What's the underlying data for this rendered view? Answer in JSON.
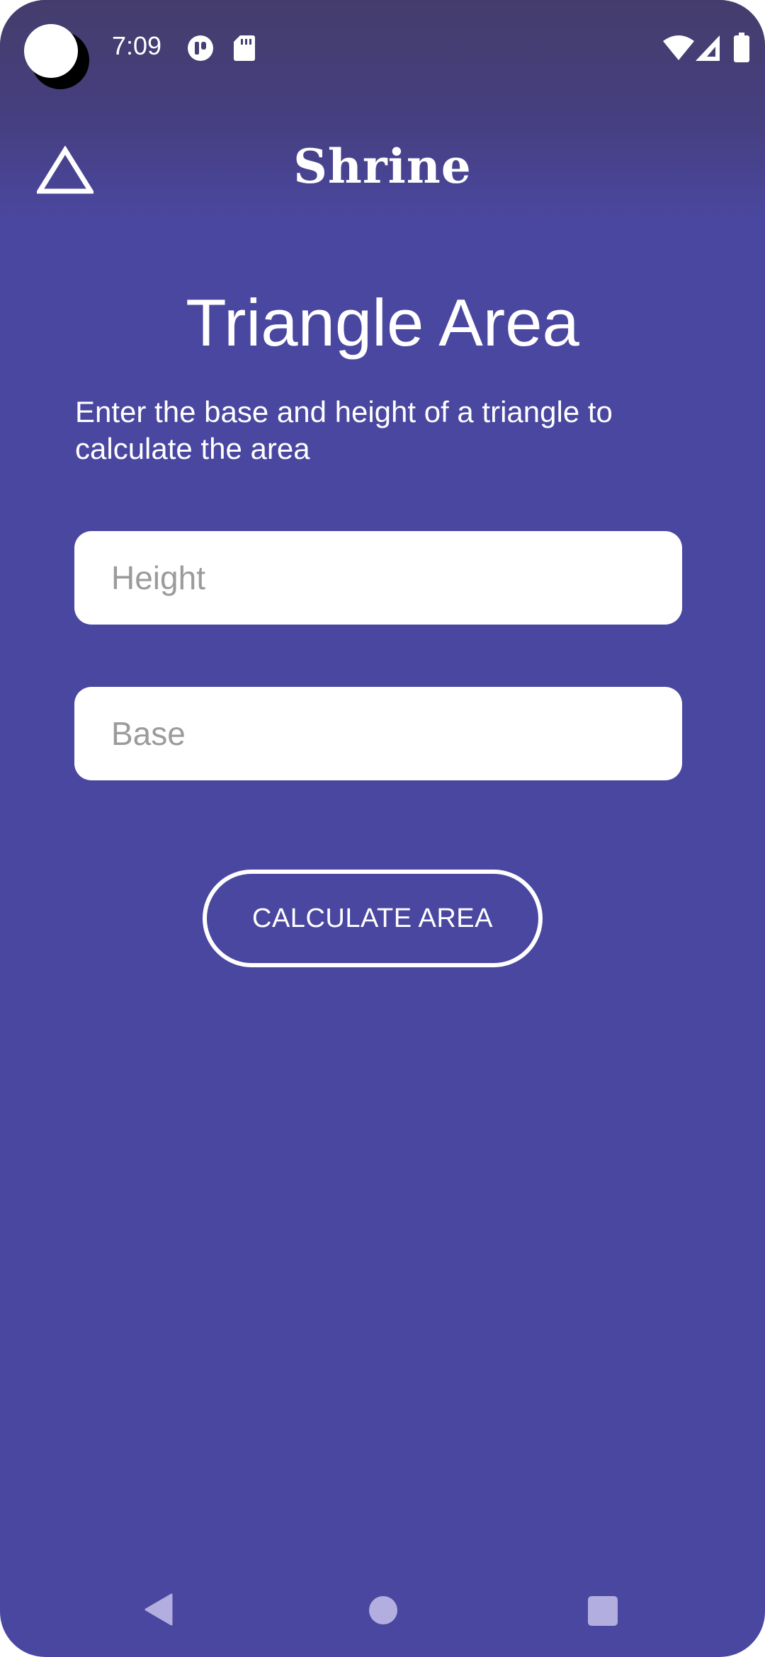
{
  "status_bar": {
    "time": "7:09",
    "left_icons": [
      "camera-cutout-icon",
      "app-notification-icon",
      "sd-card-icon"
    ],
    "right_icons": [
      "wifi-icon",
      "cellular-signal-icon",
      "battery-icon"
    ]
  },
  "app_bar": {
    "logo_icon": "triangle-outline-icon",
    "title": "Shrine"
  },
  "main": {
    "title": "Triangle Area",
    "description": "Enter the base and height of a triangle to calculate the area",
    "height_field": {
      "value": "",
      "placeholder": "Height"
    },
    "base_field": {
      "value": "",
      "placeholder": "Base"
    },
    "calculate_button": "CALCULATE AREA"
  },
  "nav_bar": {
    "buttons": [
      "back-icon",
      "home-icon",
      "recents-icon"
    ]
  },
  "colors": {
    "background": "#4a47a0",
    "status_bar_tint": "#443d6c",
    "field_background": "#ffffff",
    "placeholder": "#9b9b9b",
    "nav_icon": "#b3aee0"
  }
}
